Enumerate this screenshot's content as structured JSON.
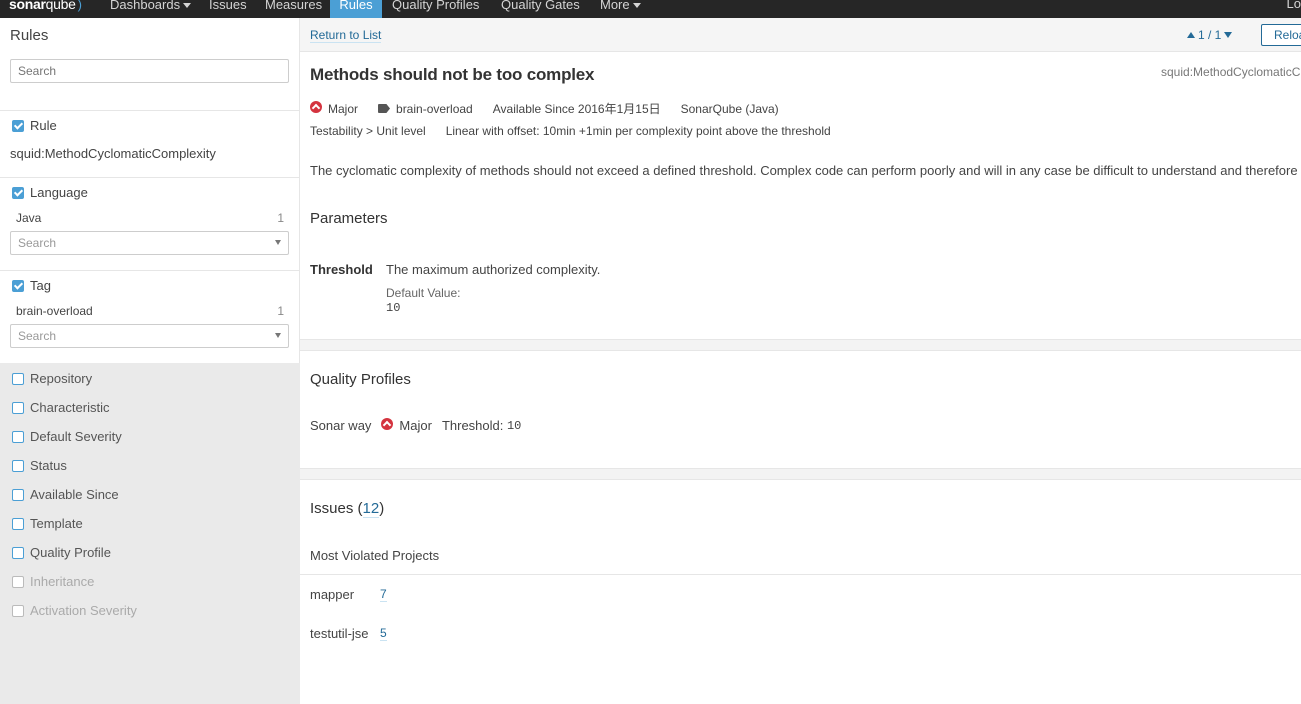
{
  "nav": {
    "logo_a": "sonar",
    "logo_b": "qube",
    "items": [
      {
        "label": "Dashboards",
        "dropdown": true
      },
      {
        "label": "Issues"
      },
      {
        "label": "Measures"
      },
      {
        "label": "Rules",
        "active": true
      },
      {
        "label": "Quality Profiles"
      },
      {
        "label": "Quality Gates"
      },
      {
        "label": "More",
        "dropdown": true
      }
    ],
    "right_label": "Lo",
    "accent": "#4b9fd5"
  },
  "sidebar": {
    "title": "Rules",
    "search_placeholder": "Search",
    "facets": {
      "rule": {
        "label": "Rule",
        "value": "squid:MethodCyclomaticComplexity"
      },
      "language": {
        "label": "Language",
        "item": "Java",
        "count": "1",
        "search": "Search"
      },
      "tag": {
        "label": "Tag",
        "item": "brain-overload",
        "count": "1",
        "search": "Search"
      },
      "collapsed": [
        {
          "label": "Repository"
        },
        {
          "label": "Characteristic"
        },
        {
          "label": "Default Severity"
        },
        {
          "label": "Status"
        },
        {
          "label": "Available Since"
        },
        {
          "label": "Template"
        },
        {
          "label": "Quality Profile"
        },
        {
          "label": "Inheritance",
          "disabled": true
        },
        {
          "label": "Activation Severity",
          "disabled": true
        }
      ]
    }
  },
  "toolbar": {
    "return_label": "Return to List",
    "pager": "1 / 1",
    "reload_label": "Reloa"
  },
  "rule": {
    "title": "Methods should not be too complex",
    "key": "squid:MethodCyclomaticC",
    "severity": "Major",
    "severity_color": "#d4333f",
    "tag": "brain-overload",
    "available_since": "Available Since 2016年1月15日",
    "repository": "SonarQube (Java)",
    "characteristic": "Testability > Unit level",
    "debt": "Linear with offset: 10min +1min per complexity point above the threshold",
    "description": "The cyclomatic complexity of methods should not exceed a defined threshold. Complex code can perform poorly and will in any case be difficult to understand and therefore"
  },
  "parameters": {
    "heading": "Parameters",
    "name": "Threshold",
    "description": "The maximum authorized complexity.",
    "default_label": "Default Value:",
    "default_value": "10"
  },
  "quality_profiles": {
    "heading": "Quality Profiles",
    "profile": "Sonar way",
    "severity": "Major",
    "threshold_label": "Threshold:",
    "threshold_value": "10"
  },
  "issues": {
    "heading": "Issues",
    "count": "12",
    "most_violated_label": "Most Violated Projects",
    "projects": [
      {
        "name": "mapper",
        "count": "7"
      },
      {
        "name": "testutil-jse",
        "count": "5"
      }
    ]
  }
}
